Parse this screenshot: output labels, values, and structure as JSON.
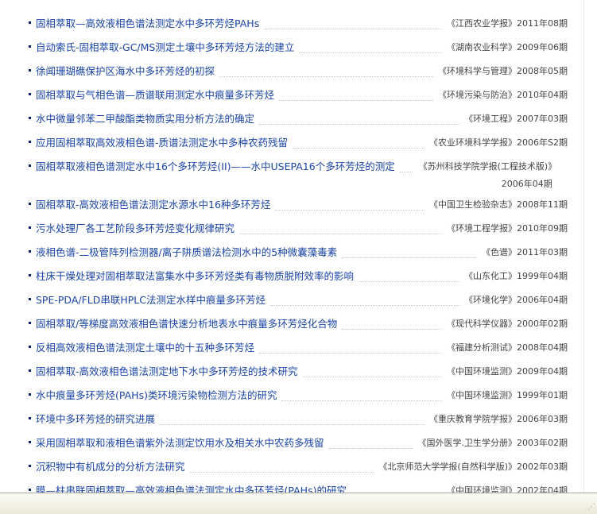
{
  "articles": [
    {
      "title": "固相萃取—高效液相色谱法测定水中多环芳烃PAHs",
      "source": "《江西农业学报》2011年08期"
    },
    {
      "title": "自动索氏-固相萃取-GC/MS测定土壤中多环芳烃方法的建立",
      "source": "《湖南农业科学》2009年06期"
    },
    {
      "title": "徐闻珊瑚礁保护区海水中多环芳烃的初探",
      "source": "《环境科学与管理》2008年05期"
    },
    {
      "title": "固相萃取与气相色谱—质谱联用测定水中痕量多环芳烃",
      "source": "《环境污染与防治》2010年04期"
    },
    {
      "title": "水中微量邻苯二甲酸酯类物质实用分析方法的确定",
      "source": "《环境工程》2007年03期"
    },
    {
      "title": "应用固相萃取高效液相色谱-质谱法测定水中多种农药残留",
      "source": "《农业环境科学学报》2006年S2期"
    },
    {
      "title": "固相萃取液相色谱测定水中16个多环芳烃(II)——水中USEPA16个多环芳烃的测定",
      "source": "《苏州科技学院学报(工程技术版)》2006年04期"
    },
    {
      "title": "固相萃取-高效液相色谱法测定水源水中16种多环芳烃",
      "source": "《中国卫生检验杂志》2008年11期"
    },
    {
      "title": "污水处理厂各工艺阶段多环芳烃变化规律研究",
      "source": "《环境工程学报》2010年09期"
    },
    {
      "title": "液相色谱-二极管阵列检测器/离子阱质谱法检测水中的5种微囊藻毒素",
      "source": "《色谱》2011年03期"
    },
    {
      "title": "柱床干燥处理对固相萃取法富集水中多环芳烃类有毒物质脱附效率的影响",
      "source": "《山东化工》1999年04期"
    },
    {
      "title": "SPE-PDA/FLD串联HPLC法测定水样中痕量多环芳烃",
      "source": "《环境化学》2006年04期"
    },
    {
      "title": "固相萃取/等梯度高效液相色谱快速分析地表水中痕量多环芳烃化合物",
      "source": "《现代科学仪器》2000年02期"
    },
    {
      "title": "反相高效液相色谱法测定土壤中的十五种多环芳烃",
      "source": "《福建分析测试》2008年04期"
    },
    {
      "title": "固相萃取-高效液相色谱法测定地下水中多环芳烃的技术研究",
      "source": "《中国环境监测》2009年04期"
    },
    {
      "title": "水中痕量多环芳烃(PAHs)类环境污染物检测方法的研究",
      "source": "《中国环境监测》1999年01期"
    },
    {
      "title": "环境中多环芳烃的研究进展",
      "source": "《重庆教育学院学报》2006年03期"
    },
    {
      "title": "采用固相萃取和液相色谱紫外法测定饮用水及相关水中农药多残留",
      "source": "《国外医学.卫生学分册》2003年02期"
    },
    {
      "title": "沉积物中有机成分的分析方法研究",
      "source": "《北京师范大学学报(自然科学版)》2002年03期"
    },
    {
      "title": "膜—柱串联固相萃取—高效液相色谱法测定水中多环芳烃(PAHs)的研究",
      "source": "《中国环境监测》2002年04期"
    }
  ]
}
